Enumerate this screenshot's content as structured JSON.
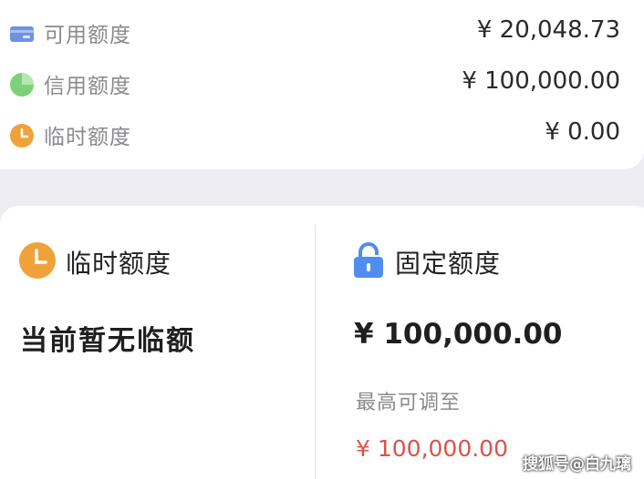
{
  "summary": {
    "rows": [
      {
        "icon": "card-icon",
        "label": "可用额度",
        "value": "¥ 20,048.73"
      },
      {
        "icon": "pie-icon",
        "label": "信用额度",
        "value": "¥ 100,000.00"
      },
      {
        "icon": "clock-icon",
        "label": "临时额度",
        "value": "¥ 0.00"
      }
    ]
  },
  "temporary_panel": {
    "icon": "clock-icon",
    "title": "临时额度",
    "status": "当前暂无临额"
  },
  "fixed_panel": {
    "icon": "lock-icon",
    "title": "固定额度",
    "value": "¥ 100,000.00",
    "max_label": "最高可调至",
    "max_value": "¥ 100,000.00"
  },
  "watermark": "搜狐号@白九璃",
  "colors": {
    "accent_orange": "#f0a23a",
    "card_blue": "#6e92e0",
    "pie_green": "#7ed07a",
    "lock_blue": "#4f8df0",
    "max_value_red": "#d9534a"
  }
}
